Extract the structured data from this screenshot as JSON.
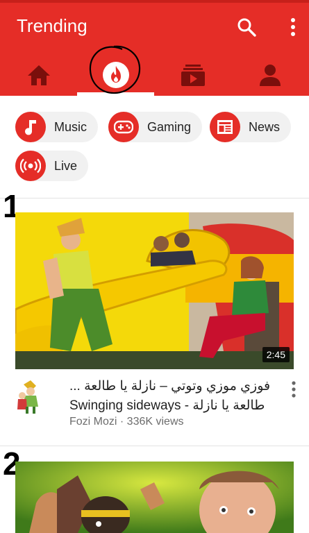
{
  "header": {
    "title": "Trending",
    "icons": [
      "search-icon",
      "more-vert-icon"
    ],
    "tabs": [
      {
        "id": "home",
        "icon": "home-icon",
        "selected": false
      },
      {
        "id": "trending",
        "icon": "flame-icon",
        "selected": true
      },
      {
        "id": "subscriptions",
        "icon": "subscriptions-icon",
        "selected": false
      },
      {
        "id": "account",
        "icon": "account-icon",
        "selected": false
      }
    ]
  },
  "colors": {
    "accent": "#e52d27",
    "chip_bg": "#f1f1f1",
    "meta_text": "#6c6c6c"
  },
  "categories": [
    {
      "label": "Music",
      "icon": "music-note-icon"
    },
    {
      "label": "Gaming",
      "icon": "gamepad-icon"
    },
    {
      "label": "News",
      "icon": "newspaper-icon"
    },
    {
      "label": "Live",
      "icon": "live-broadcast-icon"
    }
  ],
  "annotations": {
    "first": "1",
    "second": "2"
  },
  "videos": [
    {
      "duration": "2:45",
      "title_line1": "فوزي موزي وتوتي – نازلة يا طالعة ...",
      "title_line2": "Swinging sideways - طالعة يا نازلة",
      "channel": "Fozi Mozi",
      "views": "336K views",
      "meta": "Fozi Mozi · 336K views"
    }
  ]
}
